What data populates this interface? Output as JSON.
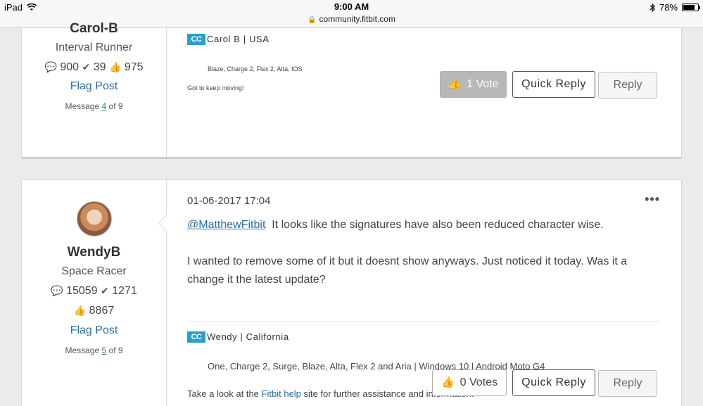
{
  "status_bar": {
    "device": "iPad",
    "time": "9:00 AM",
    "url": "community.fitbit.com",
    "battery": "78%",
    "battery_level": 0.78
  },
  "posts": [
    {
      "author": {
        "username": "Carol-B",
        "rank": "Interval Runner",
        "posts_count": "900",
        "solutions_count": "39",
        "kudos_count": "975",
        "flag_label": "Flag Post",
        "message_prefix": "Message",
        "message_number": "4",
        "message_suffix": "of 9"
      },
      "signature": {
        "badge": "CC",
        "title": "Carol B | USA",
        "devices": "Blaze, Charge 2, Flex 2, Alta, IOS",
        "tagline": "Got to keep moving!"
      },
      "actions": {
        "vote_label": "1 Vote",
        "quick_reply_label": "Quick Reply",
        "reply_label": "Reply"
      }
    },
    {
      "author": {
        "username": "WendyB",
        "rank": "Space Racer",
        "posts_count": "15059",
        "solutions_count": "1271",
        "kudos_count": "8867",
        "flag_label": "Flag Post",
        "message_prefix": "Message",
        "message_number": "5",
        "message_suffix": "of 9"
      },
      "datetime": "01-06-2017 17:04",
      "more_label": "•••",
      "body": {
        "mention": "@MatthewFitbit",
        "line1": "It looks like the signatures have also been reduced character wise.",
        "paragraph2": "I wanted to remove some of it but it doesnt show anyways. Just noticed it today. Was it a change it the latest update?"
      },
      "signature": {
        "badge": "CC",
        "title": "Wendy | California",
        "devices": "One, Charge 2, Surge, Blaze, Alta, Flex 2 and Aria | Windows 10 | Android Moto G4",
        "help_prefix": "Take a look at the",
        "help_link": "Fitbit help",
        "help_suffix": "site for further assistance and information."
      },
      "actions": {
        "vote_label": "0 Votes",
        "quick_reply_label": "Quick Reply",
        "reply_label": "Reply"
      }
    }
  ],
  "icons": {
    "wifi": "wifi-icon",
    "lock": "lock-icon",
    "bluetooth": "bluetooth-icon",
    "battery": "battery-icon",
    "posts": "speech-bubble-icon",
    "solutions": "checkmark-icon",
    "kudos": "thumbs-up-icon"
  },
  "colors": {
    "accent": "#2a6f9e",
    "badge": "#2a9fc9",
    "vote_active": "#b8b8b8"
  }
}
